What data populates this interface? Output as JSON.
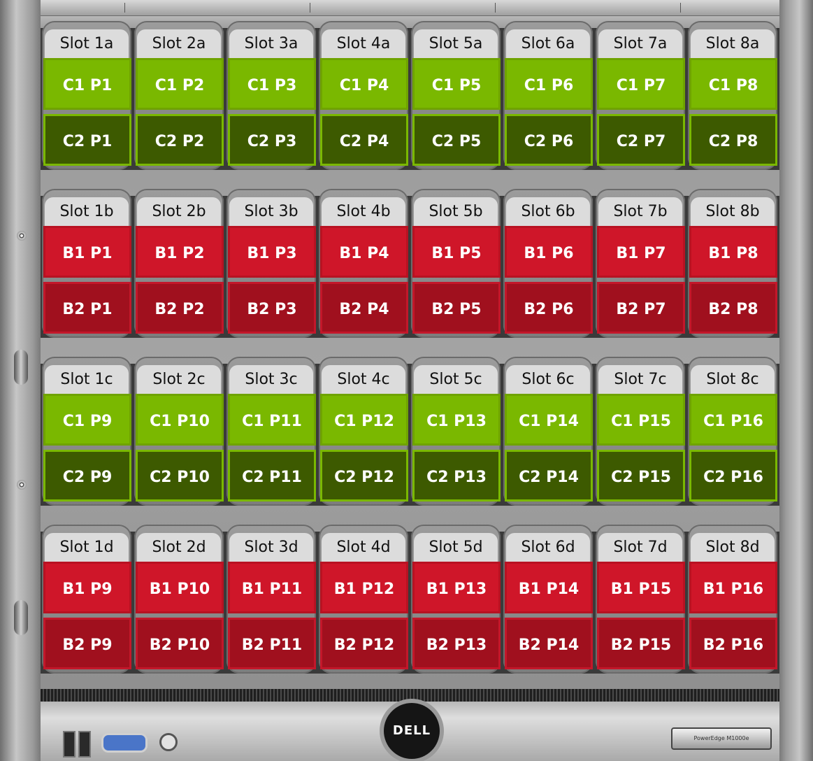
{
  "colors": {
    "c1_port": "#7ab800",
    "c2_port": "#3d5a00",
    "b1_port": "#cf1629",
    "b2_port": "#a0101e",
    "slot_label_bg": "#dcdcdc"
  },
  "rows": [
    {
      "slots": [
        "Slot 1a",
        "Slot 2a",
        "Slot 3a",
        "Slot 4a",
        "Slot 5a",
        "Slot 6a",
        "Slot 7a",
        "Slot 8a"
      ],
      "top_ports": [
        "C1 P1",
        "C1 P2",
        "C1 P3",
        "C1 P4",
        "C1 P5",
        "C1 P6",
        "C1 P7",
        "C1 P8"
      ],
      "bottom_ports": [
        "C2 P1",
        "C2 P2",
        "C2 P3",
        "C2 P4",
        "C2 P5",
        "C2 P6",
        "C2 P7",
        "C2 P8"
      ],
      "fabric": "C"
    },
    {
      "slots": [
        "Slot 1b",
        "Slot 2b",
        "Slot 3b",
        "Slot 4b",
        "Slot 5b",
        "Slot 6b",
        "Slot 7b",
        "Slot 8b"
      ],
      "top_ports": [
        "B1 P1",
        "B1 P2",
        "B1 P3",
        "B1 P4",
        "B1 P5",
        "B1 P6",
        "B1 P7",
        "B1 P8"
      ],
      "bottom_ports": [
        "B2 P1",
        "B2 P2",
        "B2 P3",
        "B2 P4",
        "B2 P5",
        "B2 P6",
        "B2 P7",
        "B2 P8"
      ],
      "fabric": "B"
    },
    {
      "slots": [
        "Slot 1c",
        "Slot 2c",
        "Slot 3c",
        "Slot 4c",
        "Slot 5c",
        "Slot 6c",
        "Slot 7c",
        "Slot 8c"
      ],
      "top_ports": [
        "C1 P9",
        "C1 P10",
        "C1 P11",
        "C1 P12",
        "C1 P13",
        "C1 P14",
        "C1 P15",
        "C1 P16"
      ],
      "bottom_ports": [
        "C2 P9",
        "C2 P10",
        "C2 P11",
        "C2 P12",
        "C2 P13",
        "C2 P14",
        "C2 P15",
        "C2 P16"
      ],
      "fabric": "C"
    },
    {
      "slots": [
        "Slot 1d",
        "Slot 2d",
        "Slot 3d",
        "Slot 4d",
        "Slot 5d",
        "Slot 6d",
        "Slot 7d",
        "Slot 8d"
      ],
      "top_ports": [
        "B1 P9",
        "B1 P10",
        "B1 P11",
        "B1 P12",
        "B1 P13",
        "B1 P14",
        "B1 P15",
        "B1 P16"
      ],
      "bottom_ports": [
        "B2 P9",
        "B2 P10",
        "B2 P11",
        "B2 P12",
        "B2 P13",
        "B2 P14",
        "B2 P15",
        "B2 P16"
      ],
      "fabric": "B"
    }
  ],
  "bezel": {
    "logo": "DELL",
    "model_plate": "PowerEdge M1000e"
  },
  "icons": [
    "usb-port-icon",
    "vga-port-icon",
    "power-button-icon",
    "screw-icon",
    "dell-logo-icon"
  ]
}
